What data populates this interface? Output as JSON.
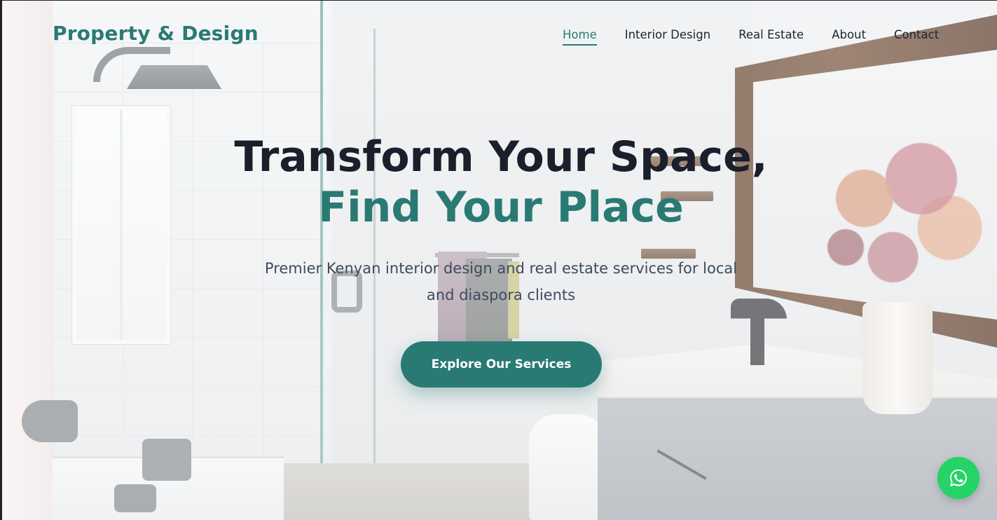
{
  "brand": {
    "name": "Property & Design"
  },
  "nav": {
    "items": [
      {
        "label": "Home",
        "active": true
      },
      {
        "label": "Interior Design",
        "active": false
      },
      {
        "label": "Real Estate",
        "active": false
      },
      {
        "label": "About",
        "active": false
      },
      {
        "label": "Contact",
        "active": false
      }
    ]
  },
  "hero": {
    "title_line1": "Transform Your Space,",
    "title_line2": "Find Your Place",
    "subtitle": "Premier Kenyan interior design and real estate services for local and diaspora clients",
    "cta_label": "Explore Our Services",
    "background_image": "bathroom-interior-photo"
  },
  "floating": {
    "whatsapp_icon": "whatsapp-icon"
  },
  "colors": {
    "accent": "#2a7a74",
    "heading": "#1a1f2b",
    "subtitle": "#3d4a5f",
    "whatsapp": "#25d366"
  }
}
